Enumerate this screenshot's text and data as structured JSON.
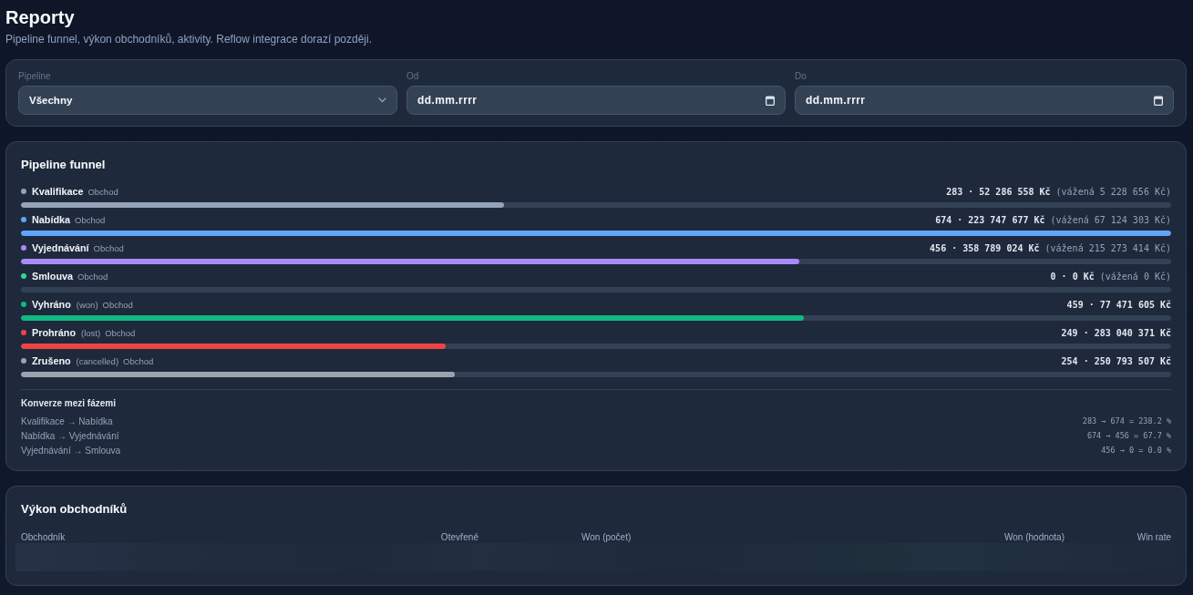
{
  "page": {
    "title": "Reporty",
    "subtitle": "Pipeline funnel, výkon obchodníků, aktivity. Reflow integrace dorazí později."
  },
  "filters": [
    {
      "kind": "select",
      "label": "Pipeline",
      "value": "Všechny"
    },
    {
      "kind": "date",
      "label": "Od",
      "placeholder": "dd.mm.rrrr"
    },
    {
      "kind": "date",
      "label": "Do",
      "placeholder": "dd.mm.rrrr"
    }
  ],
  "funnel": {
    "title": "Pipeline funnel",
    "stages": [
      {
        "name": "Kvalifikace",
        "type": "Obchod",
        "totals": "283 · 52 286 558 Kč",
        "weighted": "(vážená 5 228 656 Kč)",
        "level": 0.42,
        "color": "#94a3b8"
      },
      {
        "name": "Nabídka",
        "type": "Obchod",
        "totals": "674 · 223 747 677 Kč",
        "weighted": "(vážená 67 124 303 Kč)",
        "level": 1,
        "color": "#60a5fa"
      },
      {
        "name": "Vyjednávání",
        "type": "Obchod",
        "totals": "456 · 358 789 024 Kč",
        "weighted": "(vážená 215 273 414 Kč)",
        "level": 0.677,
        "color": "#a78bfa"
      },
      {
        "name": "Smlouva",
        "type": "Obchod",
        "totals": "0 · 0 Kč",
        "weighted": "(vážená 0 Kč)",
        "level": 0,
        "color": "#34d399"
      },
      {
        "name": "Vyhráno",
        "tag": "(won)",
        "type": "Obchod",
        "totals": "459 · 77 471 605 Kč",
        "level": 0.681,
        "color": "#10b981"
      },
      {
        "name": "Prohráno",
        "tag": "(lost)",
        "type": "Obchod",
        "totals": "249 · 283 040 371 Kč",
        "level": 0.369,
        "color": "#ef4444"
      },
      {
        "name": "Zrušeno",
        "tag": "(cancelled)",
        "type": "Obchod",
        "totals": "254 · 250 793 507 Kč",
        "level": 0.377,
        "color": "#9ca3af"
      }
    ],
    "conversions_title": "Konverze mezi fázemi",
    "conversions": [
      {
        "label": "Kvalifikace → Nabídka",
        "value": "283 → 674 = 238.2 %"
      },
      {
        "label": "Nabídka → Vyjednávání",
        "value": "674 → 456 = 67.7 %"
      },
      {
        "label": "Vyjednávání → Smlouva",
        "value": "456 → 0 = 0.0 %"
      }
    ]
  },
  "performance": {
    "title": "Výkon obchodníků",
    "columns": [
      "Obchodník",
      "Otevřené",
      "Won (počet)",
      "Won (hodnota)",
      "Win rate"
    ],
    "loading": true
  }
}
